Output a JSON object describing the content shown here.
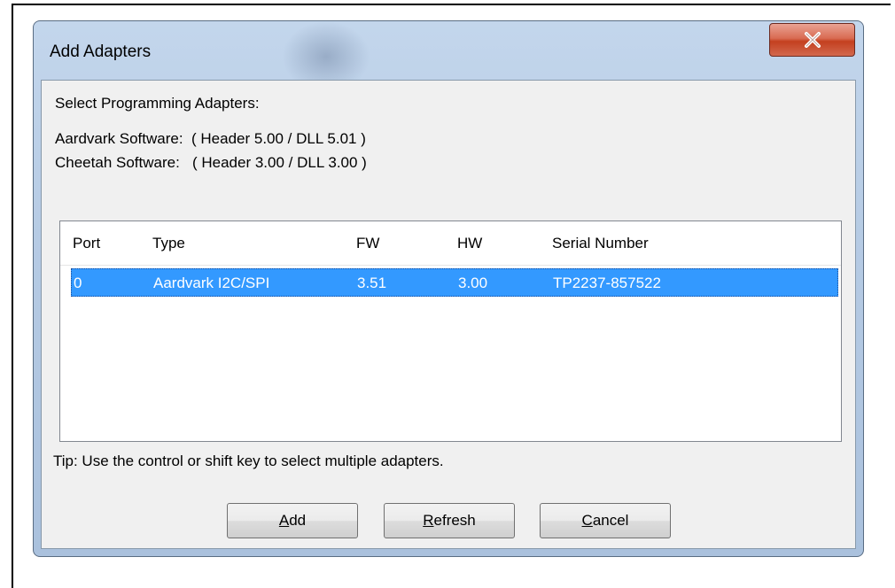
{
  "window": {
    "title": "Add Adapters"
  },
  "info": {
    "heading": "Select Programming Adapters:",
    "aardvark": "Aardvark Software:  ( Header 5.00 / DLL 5.01 )",
    "cheetah": "Cheetah Software:   ( Header 3.00 / DLL 3.00 )"
  },
  "table": {
    "columns": [
      "Port",
      "Type",
      "FW",
      "HW",
      "Serial Number"
    ],
    "rows": [
      [
        "0",
        "Aardvark I2C/SPI",
        "3.51",
        "3.00",
        "TP2237-857522"
      ]
    ]
  },
  "tip": "Tip: Use the control or shift key to select multiple adapters.",
  "buttons": {
    "add": {
      "mnemonic": "A",
      "rest": "dd"
    },
    "refresh": {
      "mnemonic": "R",
      "rest": "efresh"
    },
    "cancel": {
      "mnemonic": "C",
      "rest": "ancel"
    }
  },
  "colors": {
    "selection": "#3399ff",
    "close": "#c4401f"
  }
}
